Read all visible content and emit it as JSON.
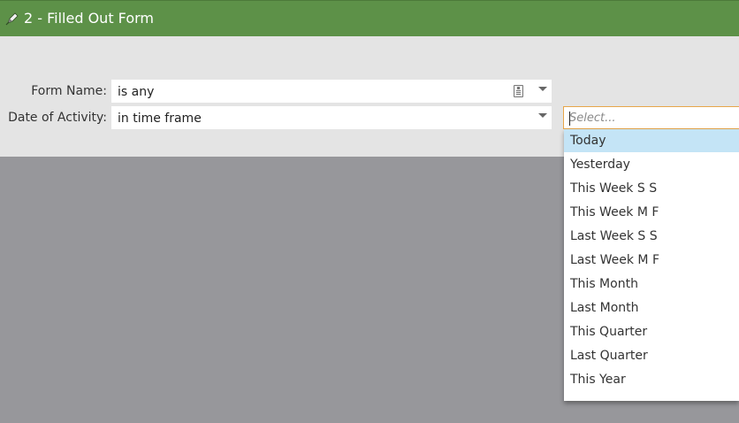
{
  "header": {
    "title": "2 - Filled Out Form",
    "icon": "pencil-icon",
    "color": "#5d9148"
  },
  "fields": [
    {
      "label": "Form Name:",
      "value": "is any"
    },
    {
      "label": "Date of Activity:",
      "value": "in time frame"
    }
  ],
  "search": {
    "placeholder": "Select...",
    "value": ""
  },
  "dropdown": {
    "highlighted": "Today",
    "highlight_color": "#c4e4f6",
    "options": [
      "Today",
      "Yesterday",
      "This Week S S",
      "This Week M F",
      "Last Week S S",
      "Last Week M F",
      "This Month",
      "Last Month",
      "This Quarter",
      "Last Quarter",
      "This Year"
    ]
  }
}
